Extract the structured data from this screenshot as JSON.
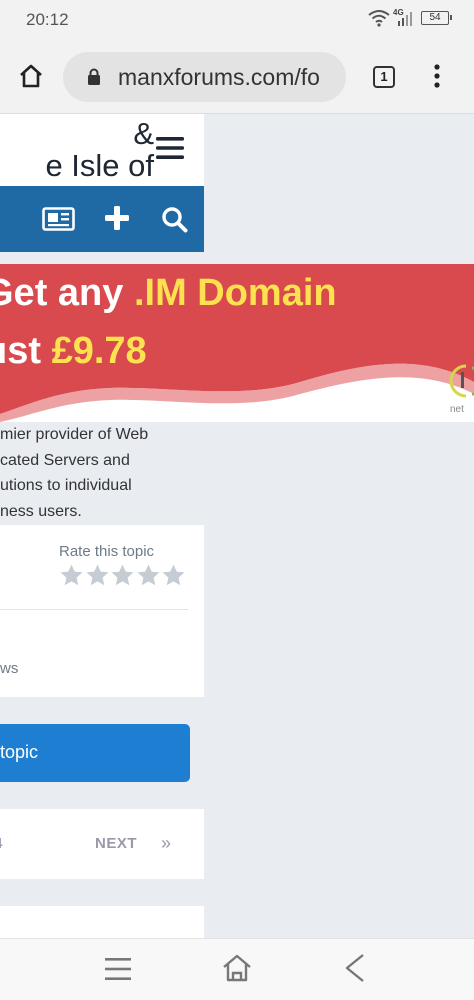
{
  "status_bar": {
    "time": "20:12",
    "network_type": "4G",
    "battery_level": "54"
  },
  "browser": {
    "url": "manxforums.com/fo",
    "tab_count": "1"
  },
  "site": {
    "title": "&\ne Isle of"
  },
  "ad": {
    "line1_prefix": "Get any ",
    "line1_highlight": ".IM Domain",
    "line2_prefix": "ust ",
    "line2_highlight": "£9.78",
    "logo_text": "net",
    "description": [
      "mier provider of Web",
      "cated Servers and",
      "utions to individual",
      "ness users."
    ],
    "colors": {
      "banner": "#d94a4f",
      "highlight": "#fde24f"
    }
  },
  "topic": {
    "rate_label": "Rate this topic",
    "star_count": 5,
    "rating": 0,
    "views_label": "ws"
  },
  "reply_button": {
    "label": "topic"
  },
  "pagination": {
    "page_fragment": "4",
    "next_label": "NEXT",
    "next_icon": "»"
  },
  "colors": {
    "navbar": "#1f6aa5",
    "primary_button": "#1e7fd2",
    "page_background": "#e9edf2"
  }
}
